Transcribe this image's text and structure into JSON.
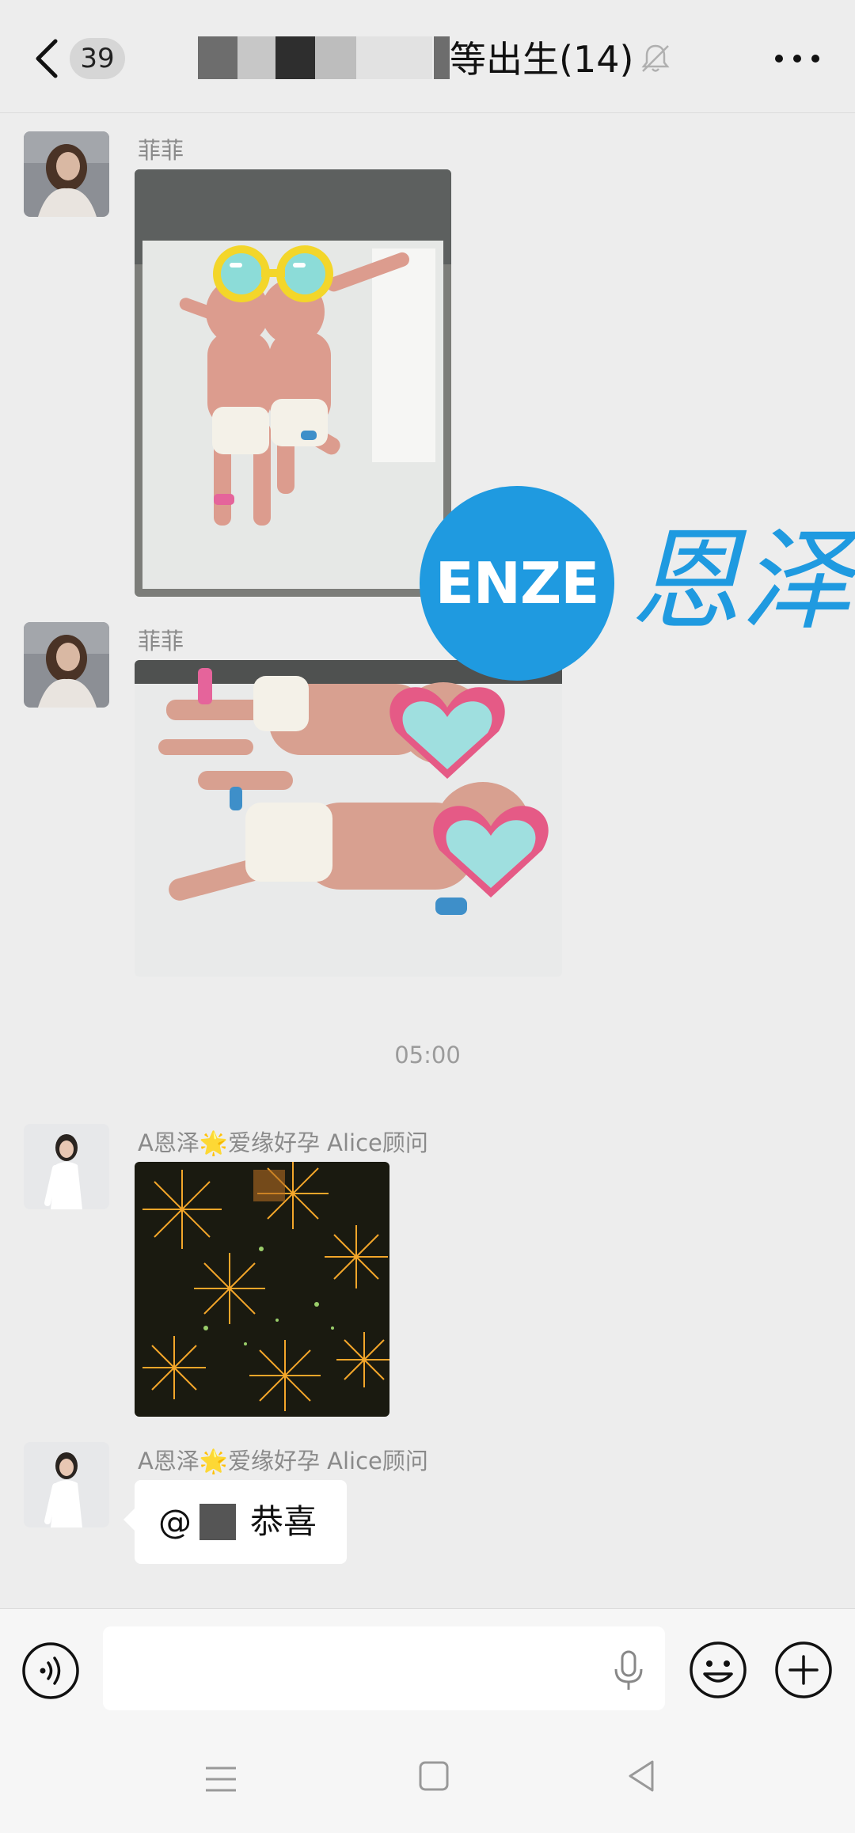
{
  "header": {
    "unread_count": "39",
    "title": "等出生(14)"
  },
  "messages": [
    {
      "sender": "菲菲"
    },
    {
      "sender": "菲菲"
    },
    {
      "sender": "A恩泽🌟爱缘好孕 Alice顾问"
    },
    {
      "sender": "A恩泽🌟爱缘好孕 Alice顾问"
    }
  ],
  "timestamp": "05:00",
  "mention": {
    "at": "@",
    "text": "恭喜"
  },
  "watermark": {
    "latin": "ENZE",
    "chinese": "恩泽"
  },
  "input": {
    "value": "",
    "placeholder": ""
  },
  "colors": {
    "background": "#ededed",
    "watermark_blue": "#1f9ae0"
  }
}
